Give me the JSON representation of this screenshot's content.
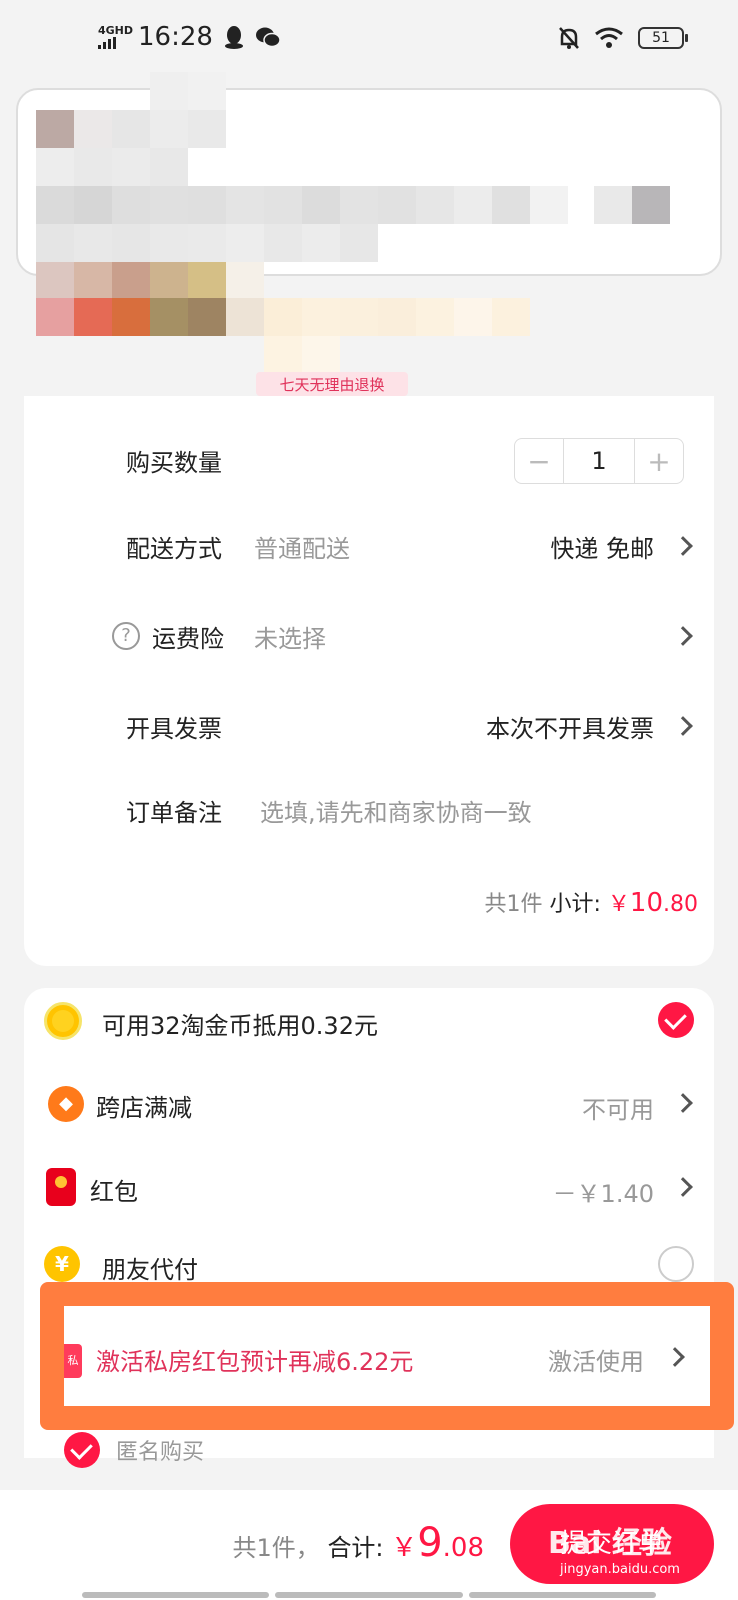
{
  "status_bar": {
    "network": "4GHD",
    "time": "16:28",
    "battery": "51"
  },
  "order": {
    "refund_tag": "七天无理由退换",
    "quantity_label": "购买数量",
    "quantity_value": "1",
    "minus": "−",
    "plus": "+",
    "delivery_label": "配送方式",
    "delivery_sub": "普通配送",
    "delivery_value": "快递 免邮",
    "insurance_label": "运费险",
    "insurance_sub": "未选择",
    "help_icon": "?",
    "invoice_label": "开具发票",
    "invoice_value": "本次不开具发票",
    "note_label": "订单备注",
    "note_placeholder": "选填,请先和商家协商一致",
    "subtotal_count": "共1件",
    "subtotal_label": "小计:",
    "subtotal_currency": "￥",
    "subtotal_int": "10",
    "subtotal_dec": ".80"
  },
  "benefits": {
    "coins_label": "可用32淘金币抵用0.32元",
    "cross_store_label": "跨店满减",
    "cross_store_value": "不可用",
    "cross_store_icon": "◆",
    "redpacket_label": "红包",
    "redpacket_value": "－￥1.40",
    "friend_pay_label": "朋友代付",
    "friend_pay_icon": "¥",
    "private_redpacket_label": "激活私房红包预计再减6.22元",
    "private_redpacket_action": "激活使用",
    "private_icon": "私",
    "anonymous_label": "匿名购买"
  },
  "bottom": {
    "total_count": "共1件，",
    "total_label": "合计:",
    "currency": "￥",
    "total_int": "9",
    "total_dec": ".08",
    "submit": "提交订单",
    "watermark_brand": "Bai 经验",
    "watermark_url": "jingyan.baidu.com"
  },
  "colors": {
    "accent": "#ff1744",
    "highlight": "#ff7d3f",
    "background": "#f3f3f3"
  }
}
